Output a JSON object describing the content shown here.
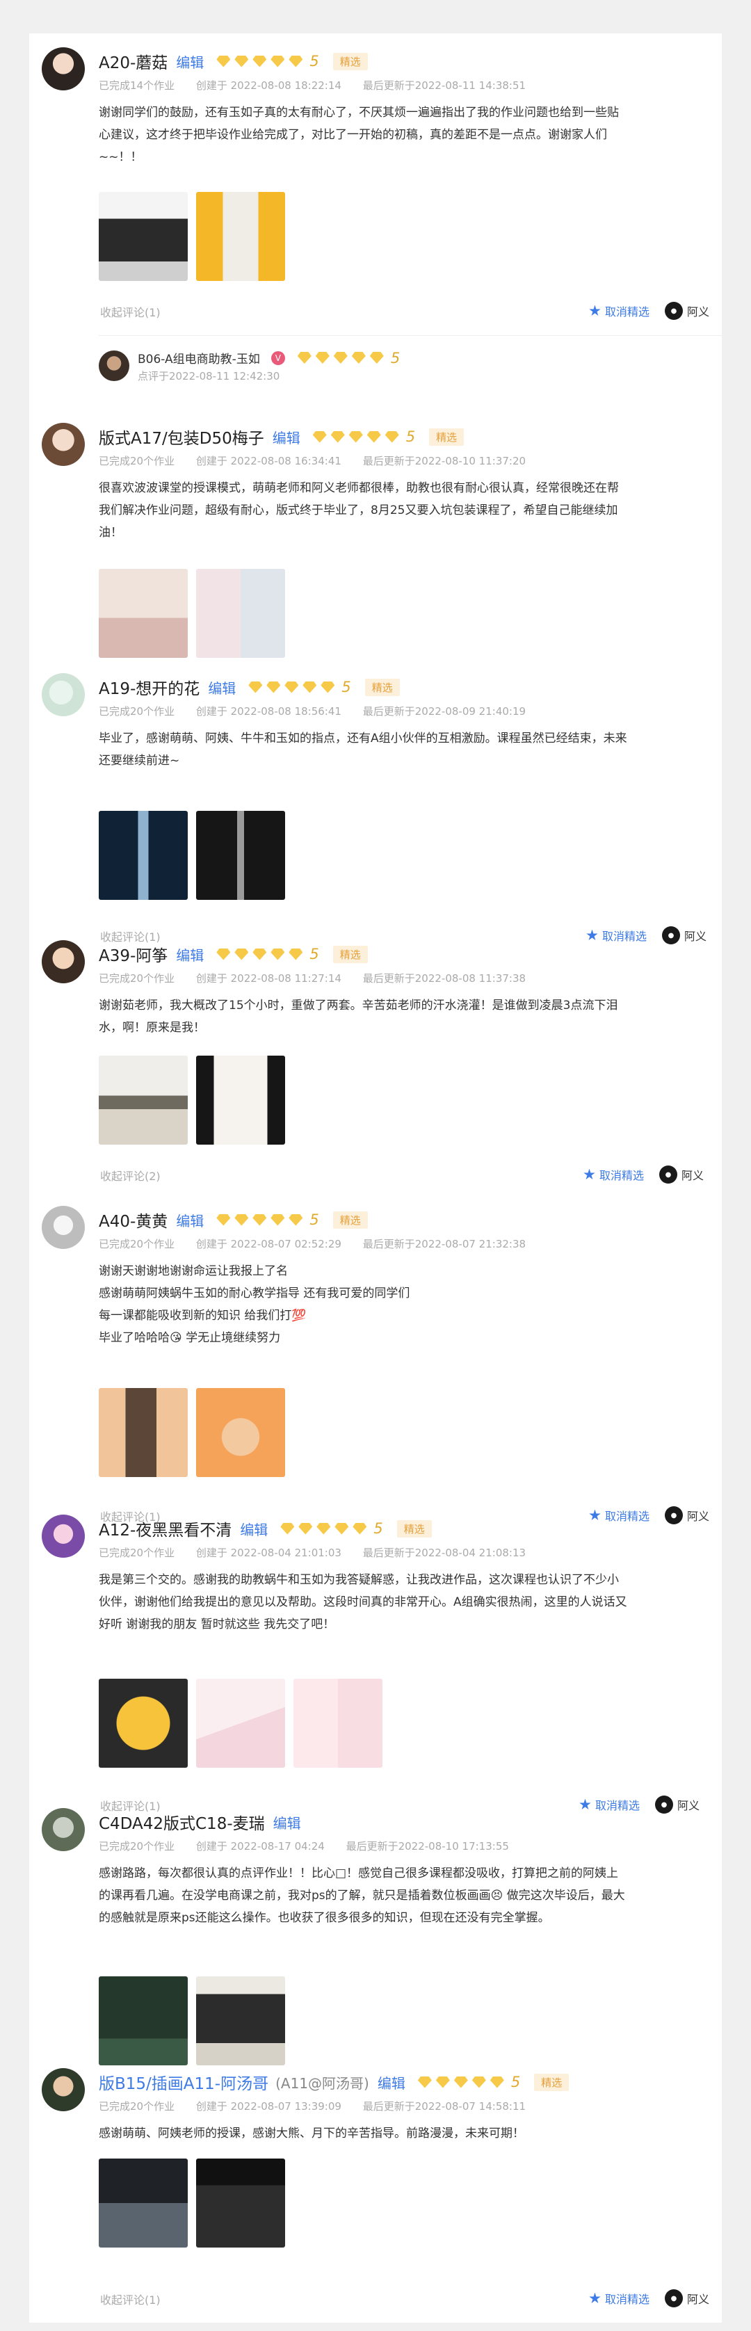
{
  "colors": {
    "accent": "#3e7be6",
    "star": "#f7c948",
    "tag_bg": "#fdf0da",
    "tag_text": "#e5a03b"
  },
  "posts": [
    {
      "name": "A20-蘑菇",
      "edit": "编辑",
      "score": "5",
      "tag": "精选",
      "completed": "已完成14个作业",
      "created": "创建于 2022-08-08 18:22:14",
      "updated": "最后更新于2022-08-11 14:38:51",
      "body": "谢谢同学们的鼓励，还有玉如子真的太有耐心了，不厌其烦一遍遍指出了我的作业问题也给到一些贴心建议，这才终于把毕设作业给完成了，对比了一开始的初稿，真的差距不是一点点。谢谢家人们~~！！",
      "thumbs": [
        "coffee-machine",
        "yellow-product"
      ],
      "collect": "收起评论(1)",
      "feature": "取消精选",
      "peer": "阿义",
      "reply": {
        "name": "B06-A组电商助教-玉如",
        "badge": "V",
        "score": "5",
        "time": "点评于2022-08-11 12:42:30"
      }
    },
    {
      "name": "版式A17/包装D50梅子",
      "edit": "编辑",
      "score": "5",
      "tag": "精选",
      "completed": "已完成20个作业",
      "created": "创建于 2022-08-08 16:34:41",
      "updated": "最后更新于2022-08-10 11:37:20",
      "body": "很喜欢波波课堂的授课模式，萌萌老师和阿义老师都很棒，助教也很有耐心很认真，经常很晚还在帮我们解决作业问题，超级有耐心，版式终于毕业了，8月25又要入坑包装课程了，希望自己能继续加油！",
      "thumbs": [
        "poster-pink",
        "packaging-gray"
      ]
    },
    {
      "name": "A19-想开的花",
      "edit": "编辑",
      "score": "5",
      "tag": "精选",
      "completed": "已完成20个作业",
      "created": "创建于 2022-08-08 18:56:41",
      "updated": "最后更新于2022-08-09 21:40:19",
      "body": "毕业了，感谢萌萌、阿姨、牛牛和玉如的指点，还有A组小伙伴的互相激励。课程虽然已经结束，未来还要继续前进~",
      "thumbs": [
        "faucet-blue",
        "faucet-dark"
      ],
      "collect": "收起评论(1)",
      "feature": "取消精选",
      "peer": "阿义"
    },
    {
      "name": "A39-阿筝",
      "edit": "编辑",
      "score": "5",
      "tag": "精选",
      "completed": "已完成20个作业",
      "created": "创建于 2022-08-08 11:27:14",
      "updated": "最后更新于2022-08-08 11:37:38",
      "body": "谢谢茹老师，我大概改了15个小时，重做了两套。辛苦茹老师的汗水浇灌！是谁做到凌晨3点流下泪水，啊！原来是我！",
      "thumbs": [
        "interior-beige",
        "bottles-white"
      ],
      "collect": "收起评论(2)",
      "feature": "取消精选",
      "peer": "阿义"
    },
    {
      "name": "A40-黄黄",
      "edit": "编辑",
      "score": "5",
      "tag": "精选",
      "completed": "已完成20个作业",
      "created": "创建于 2022-08-07 02:52:29",
      "updated": "最后更新于2022-08-07 21:32:38",
      "body": "谢谢天谢谢地谢谢命运让我报上了名\n感谢萌萌阿姨蜗牛玉如的耐心教学指导 还有我可爱的同学们\n每一课都能吸收到新的知识 给我们打💯\n毕业了哈哈哈😘 学无止境继续努力",
      "thumbs": [
        "serum-bottle",
        "orange-product"
      ],
      "collect": "收起评论(1)",
      "feature": "取消精选",
      "peer": "阿义"
    },
    {
      "name": "A12-夜黑黑看不清",
      "edit": "编辑",
      "score": "5",
      "tag": "精选",
      "completed": "已完成20个作业",
      "created": "创建于 2022-08-04 21:01:03",
      "updated": "最后更新于2022-08-04 21:08:13",
      "body": "我是第三个交的。感谢我的助教蜗牛和玉如为我答疑解惑，让我改进作品，这次课程也认识了不少小伙伴，谢谢他们给我提出的意见以及帮助。这段时间真的非常开心。A组确实很热闹，这里的人说话又好听 谢谢我的朋友 暂时就这些 我先交了吧！",
      "thumbs": [
        "cartoon-yellow",
        "pink-soft",
        "pink-cards"
      ],
      "collect": "收起评论(1)",
      "feature": "取消精选",
      "peer": "阿义"
    },
    {
      "name": "C4DA42版式C18-麦瑞",
      "edit": "编辑",
      "completed": "已完成20个作业",
      "created": "创建于 2022-08-17 04:24",
      "updated": "最后更新于2022-08-10 17:13:55",
      "body": "感谢路路，每次都很认真的点评作业！！比心□！感觉自己很多课程都没吸收，打算把之前的阿姨上的课再看几遍。在没学电商课之前，我对ps的了解，就只是插着数位板画画😣 做完这次毕设后，最大的感触就是原来ps还能这么操作。也收获了很多很多的知识，但现在还没有完全掌握。",
      "thumbs": [
        "green-poster",
        "espresso-machine"
      ]
    },
    {
      "name": "版B15/插画A11-阿汤哥",
      "nick": "(A11@阿汤哥)",
      "edit": "编辑",
      "score": "5",
      "tag": "精选",
      "completed": "已完成20个作业",
      "created": "创建于 2022-08-07 13:39:09",
      "updated": "最后更新于2022-08-07 14:58:11",
      "body": "感谢萌萌、阿姨老师的授课，感谢大熊、月下的辛苦指导。前路漫漫，未来可期！",
      "thumbs": [
        "dark-landscape",
        "dark-products"
      ],
      "collect": "收起评论(1)",
      "feature": "取消精选",
      "peer": "阿义"
    }
  ]
}
